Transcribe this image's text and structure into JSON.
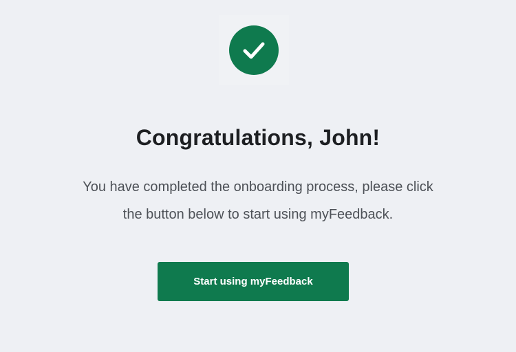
{
  "success": {
    "icon": "checkmark-icon",
    "icon_color": "#0f7a4e"
  },
  "title": "Congratulations, John!",
  "message": {
    "line1": "You have completed the onboarding process, please click",
    "line2": "the button below to start using myFeedback."
  },
  "cta": {
    "label": "Start using myFeedback",
    "color": "#0f7a4e"
  }
}
